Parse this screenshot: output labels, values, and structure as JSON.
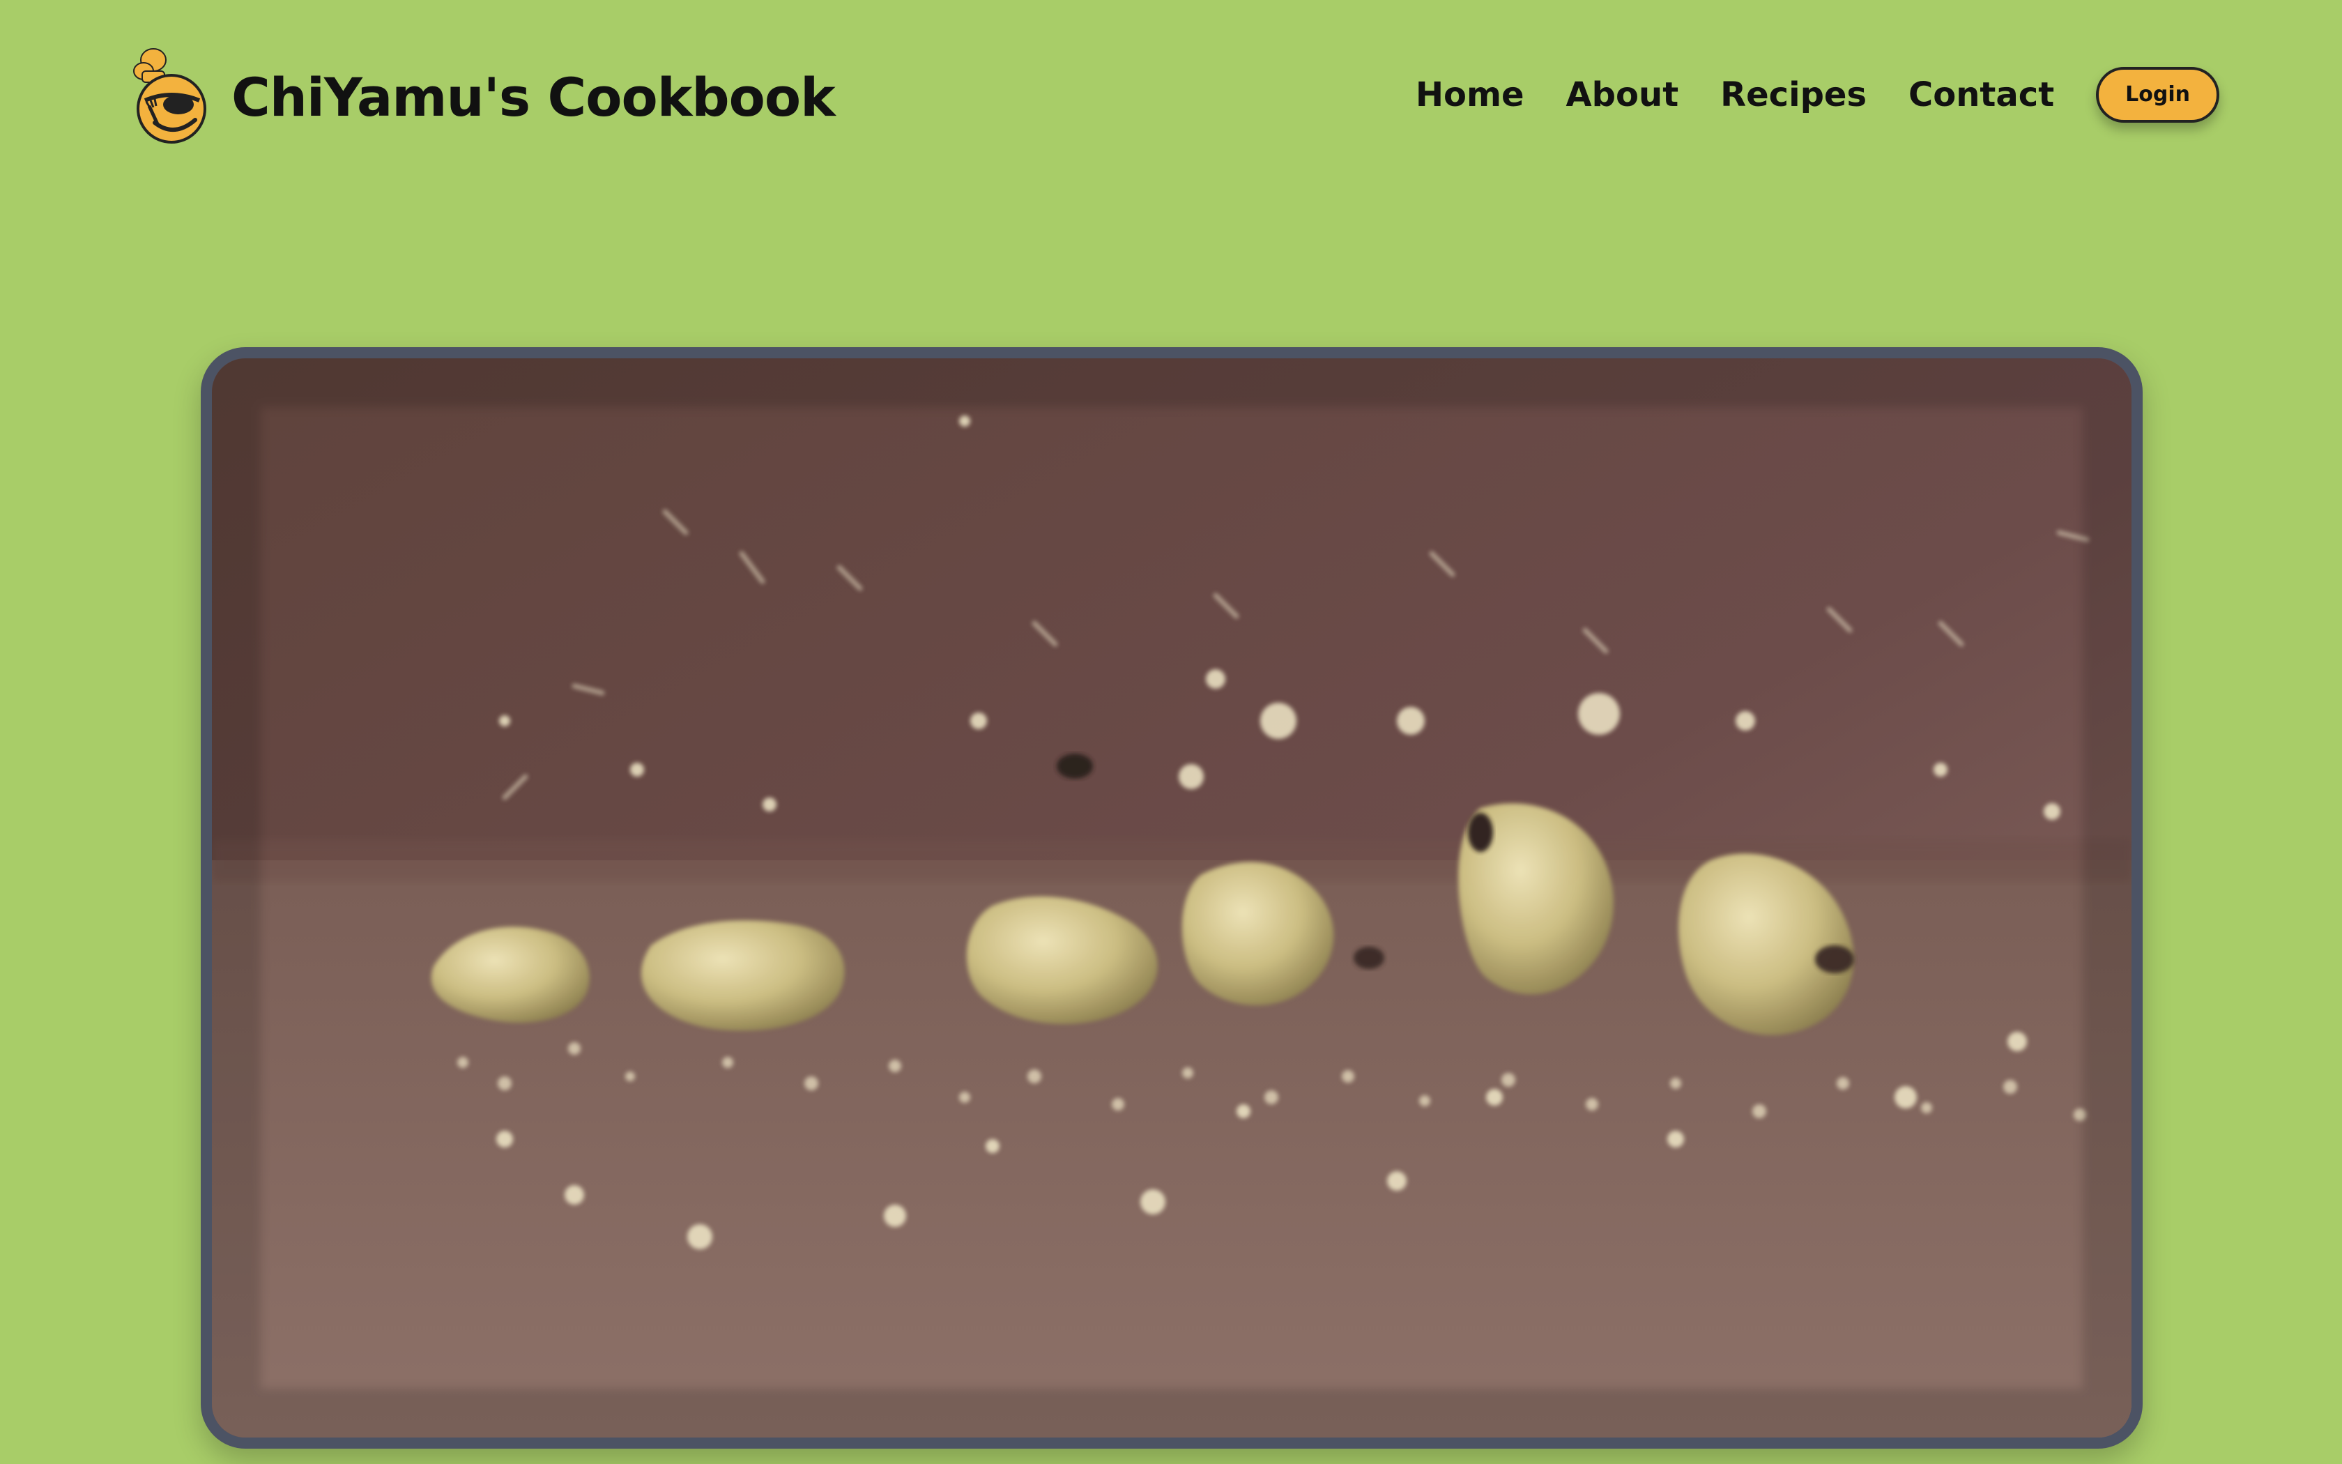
{
  "header": {
    "brand_title": "ChiYamu's Cookbook",
    "logo_icon": "chef-emoji-icon"
  },
  "nav": {
    "items": [
      "Home",
      "About",
      "Recipes",
      "Contact"
    ],
    "login_label": "Login"
  },
  "hero": {
    "media_icon": "falling-cookie-crumbs-video"
  },
  "colors": {
    "background": "#a8cd68",
    "frame_border": "#4c5364",
    "accent": "#f3b23e",
    "text": "#111111"
  }
}
